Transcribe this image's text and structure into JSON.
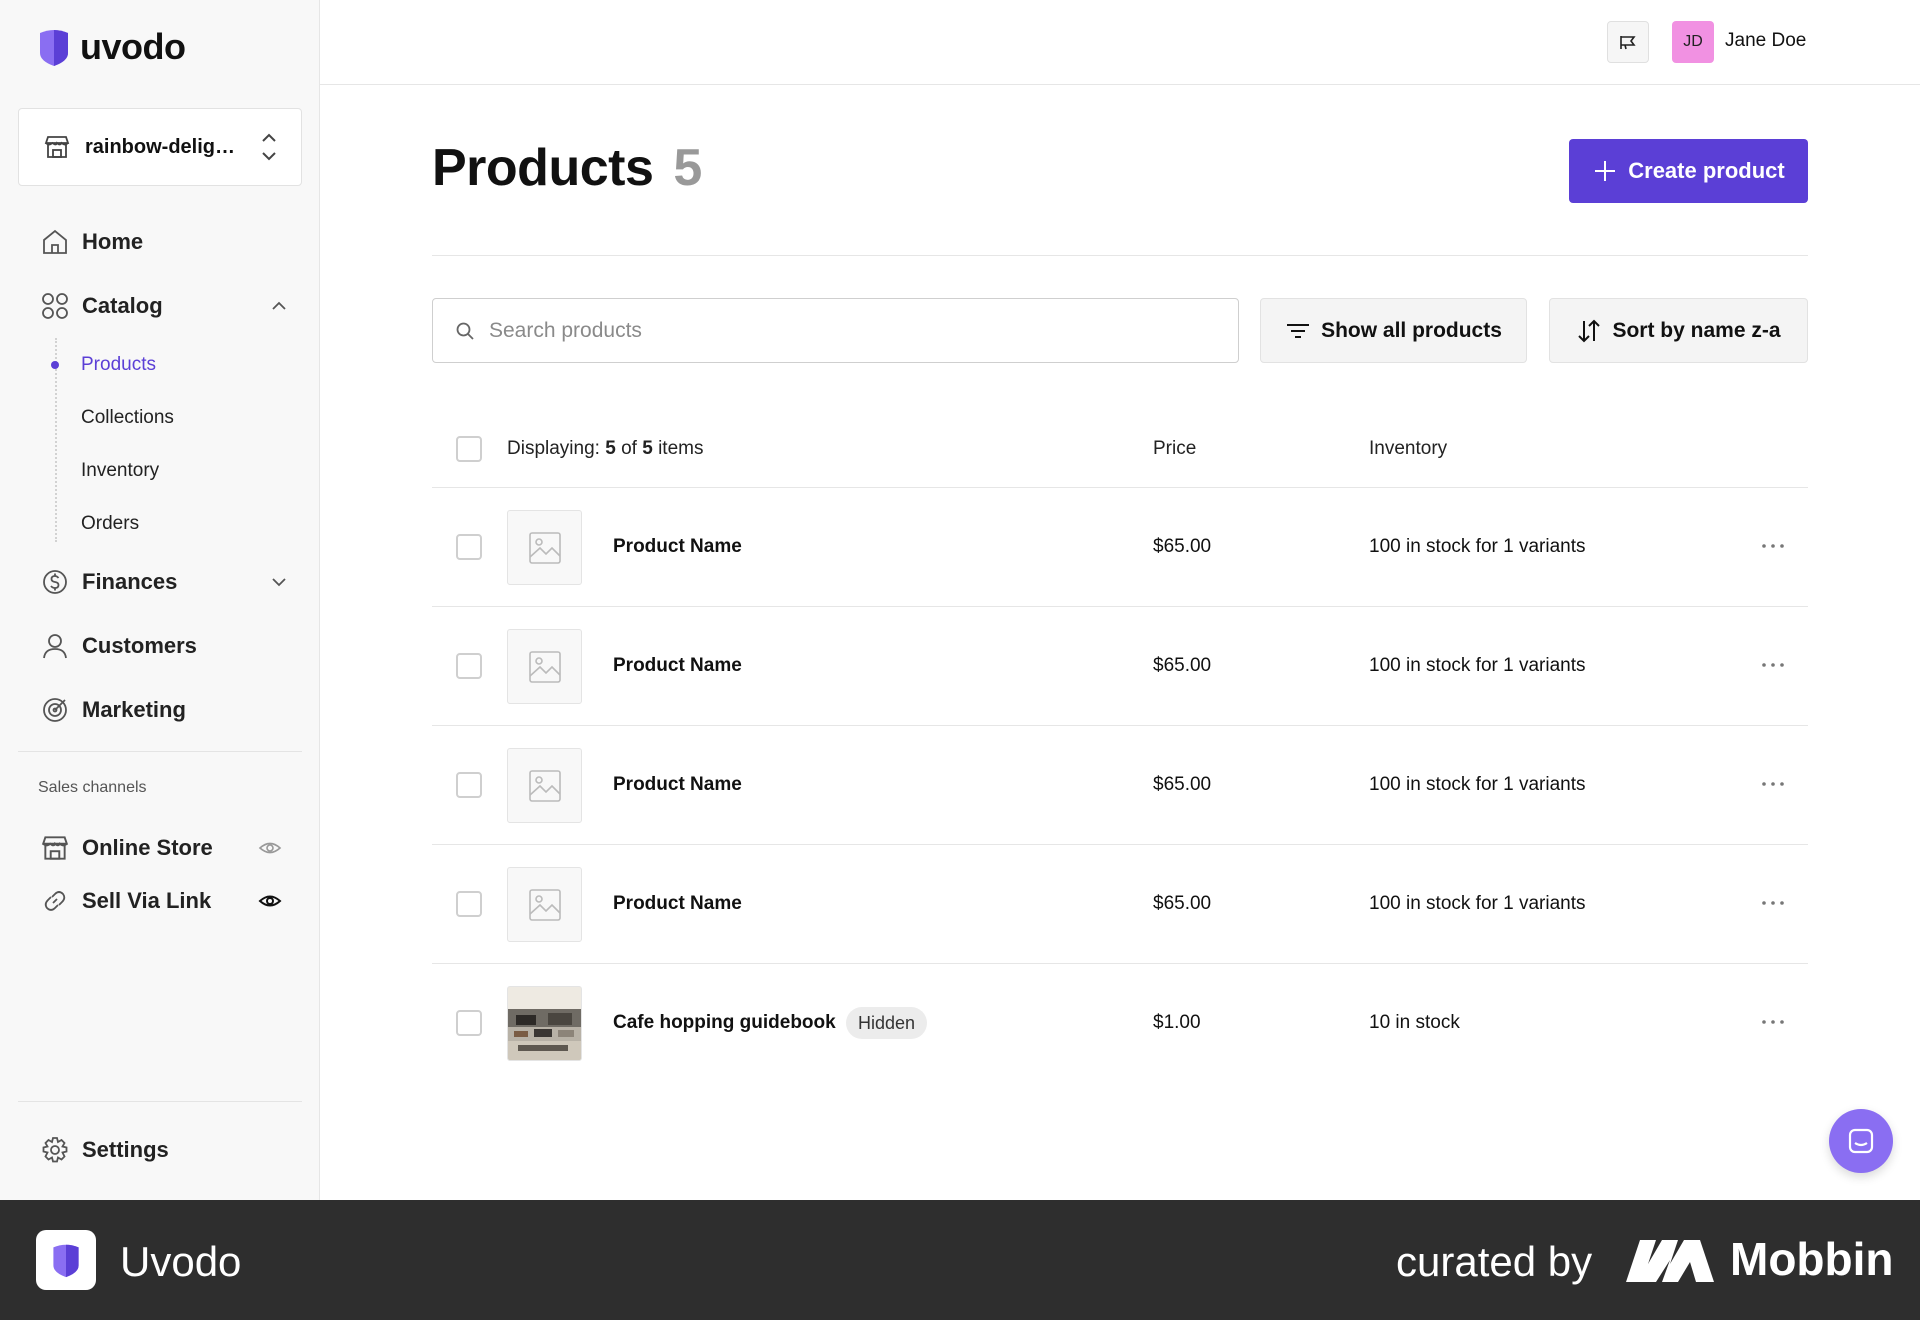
{
  "app": {
    "logo_text": "uvodo",
    "brand_color": "#5b3fd6"
  },
  "store_switcher": {
    "store_name": "rainbow-delight..."
  },
  "sidebar": {
    "nav": [
      {
        "label": "Home",
        "icon": "home-icon"
      },
      {
        "label": "Catalog",
        "icon": "catalog-icon",
        "expanded": true
      },
      {
        "label": "Finances",
        "icon": "finances-icon",
        "expanded": false
      },
      {
        "label": "Customers",
        "icon": "customers-icon"
      },
      {
        "label": "Marketing",
        "icon": "marketing-icon"
      }
    ],
    "catalog_sub": [
      {
        "label": "Products",
        "active": true
      },
      {
        "label": "Collections"
      },
      {
        "label": "Inventory"
      },
      {
        "label": "Orders"
      }
    ],
    "sales_channels_label": "Sales channels",
    "channels": [
      {
        "label": "Online Store",
        "icon": "store-icon",
        "visibility_icon": "eye-icon"
      },
      {
        "label": "Sell Via Link",
        "icon": "link-icon",
        "visibility_icon": "eye-icon"
      }
    ],
    "settings_label": "Settings"
  },
  "topbar": {
    "avatar_initials": "JD",
    "avatar_color": "#f191e2",
    "user_name": "Jane Doe"
  },
  "main": {
    "title": "Products",
    "count": "5",
    "create_button": "Create product",
    "search_placeholder": "Search products",
    "filter_button": "Show all products",
    "sort_button": "Sort by name z-a"
  },
  "table": {
    "displaying_prefix": "Displaying:",
    "shown": "5",
    "of_text": "of",
    "total": "5",
    "items_text": "items",
    "col_price": "Price",
    "col_inventory": "Inventory",
    "rows": [
      {
        "name": "Product Name",
        "price": "$65.00",
        "inventory": "100 in stock for 1 variants",
        "badge": ""
      },
      {
        "name": "Product Name",
        "price": "$65.00",
        "inventory": "100 in stock for 1 variants",
        "badge": ""
      },
      {
        "name": "Product Name",
        "price": "$65.00",
        "inventory": "100 in stock for 1 variants",
        "badge": ""
      },
      {
        "name": "Product Name",
        "price": "$65.00",
        "inventory": "100 in stock for 1 variants",
        "badge": ""
      },
      {
        "name": "Cafe hopping guidebook",
        "price": "$1.00",
        "inventory": "10 in stock",
        "badge": "Hidden"
      }
    ]
  },
  "footer": {
    "app_name": "Uvodo",
    "curated_by": "curated by",
    "mobbin": "Mobbin"
  }
}
